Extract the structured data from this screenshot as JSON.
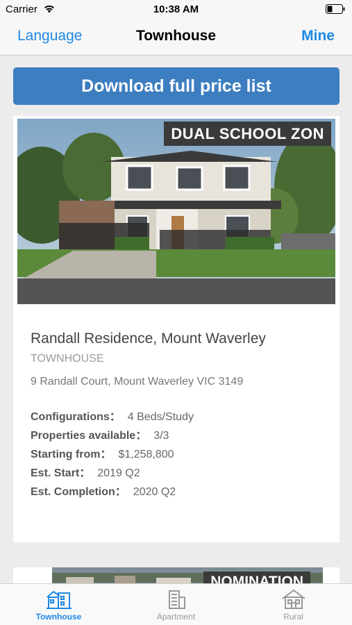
{
  "status": {
    "carrier": "Carrier",
    "time": "10:38 AM"
  },
  "nav": {
    "left": "Language",
    "title": "Townhouse",
    "right": "Mine"
  },
  "download_label": "Download full price list",
  "listing": {
    "tag": "DUAL SCHOOL ZON",
    "title": "Randall Residence, Mount Waverley",
    "type": "TOWNHOUSE",
    "address": "9 Randall Court, Mount Waverley VIC 3149",
    "details": [
      {
        "label": "Configurations：",
        "value": "4 Beds/Study"
      },
      {
        "label": "Properties available：",
        "value": "3/3"
      },
      {
        "label": "Starting from：",
        "value": "$1,258,800"
      },
      {
        "label": "Est. Start：",
        "value": "2019 Q2"
      },
      {
        "label": "Est. Completion：",
        "value": "2020 Q2"
      }
    ]
  },
  "next_listing": {
    "tag": "NOMINATION"
  },
  "tabs": [
    {
      "label": "Townhouse",
      "icon": "townhouse-icon",
      "active": true
    },
    {
      "label": "Apartment",
      "icon": "apartment-icon",
      "active": false
    },
    {
      "label": "Rural",
      "icon": "rural-house-icon",
      "active": false
    }
  ],
  "colors": {
    "accent": "#1e88e5",
    "button": "#3c7ec0",
    "tag_bg": "#3a3a3a"
  }
}
